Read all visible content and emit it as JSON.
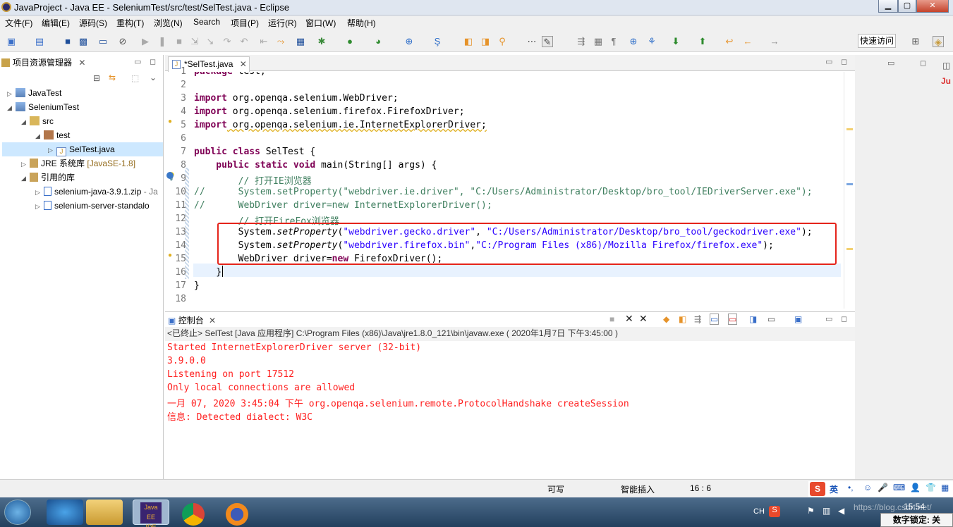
{
  "window": {
    "title": "JavaProject - Java EE - SeleniumTest/src/test/SelTest.java - Eclipse",
    "min": "▁",
    "max": "▢",
    "close": "✕"
  },
  "menu": [
    "文件(F)",
    "编辑(E)",
    "源码(S)",
    "重构(T)",
    "浏览(N)",
    "Search",
    "项目(P)",
    "运行(R)",
    "窗口(W)",
    "帮助(H)"
  ],
  "toolbar": {
    "quick_access": "快速访问"
  },
  "explorer": {
    "tab_label": "项目资源管理器",
    "items": [
      {
        "label": "JavaTest"
      },
      {
        "label": "SeleniumTest"
      },
      {
        "label": "src"
      },
      {
        "label": "test"
      },
      {
        "label": "SelTest.java"
      },
      {
        "label": "JRE 系统库",
        "suffix": "[JavaSE-1.8]"
      },
      {
        "label": "引用的库"
      },
      {
        "label": "selenium-java-3.9.1.zip",
        "suffix": "- Ja"
      },
      {
        "label": "selenium-server-standalo"
      }
    ]
  },
  "editor": {
    "tab_label": "*SelTest.java",
    "line_numbers": [
      "1",
      "2",
      "3",
      "4",
      "5",
      "6",
      "7",
      "8",
      "9",
      "10",
      "11",
      "12",
      "13",
      "14",
      "15",
      "16",
      "17",
      "18"
    ],
    "lines": {
      "l1a": "package",
      "l1b": " test;",
      "l3a": "import",
      "l3b": " org.openqa.selenium.WebDriver;",
      "l4a": "import",
      "l4b": " org.openqa.selenium.firefox.FirefoxDriver;",
      "l5a": "import",
      "l5b": " org.openqa.selenium.ie.InternetExplorerDriver;",
      "l7a": "public class",
      "l7b": " SelTest {",
      "l8a": "    public static void",
      "l8b": " main(String[] args) {",
      "l9": "        // 打开IE浏览器",
      "l10": "//      System.setProperty(\"webdriver.ie.driver\", \"C:/Users/Administrator/Desktop/bro_tool/IEDriverServer.exe\");",
      "l11": "//      WebDriver driver=new InternetExplorerDriver();",
      "l12": "        // 打开FireFox浏览器",
      "l13a": "        System.",
      "l13b": "setProperty",
      "l13c": "(",
      "l13d": "\"webdriver.gecko.driver\"",
      "l13e": ", ",
      "l13f": "\"C:/Users/Administrator/Desktop/bro_tool/geckodriver.exe\"",
      "l13g": ");",
      "l14a": "        System.",
      "l14b": "setProperty",
      "l14c": "(",
      "l14d": "\"webdriver.firefox.bin\"",
      "l14e": ",",
      "l14f": "\"C:/Program Files (x86)/Mozilla Firefox/firefox.exe\"",
      "l14g": ");",
      "l15a": "        WebDriver driver=",
      "l15b": "new",
      "l15c": " FirefoxDriver();",
      "l16": "    }",
      "l17": "}"
    }
  },
  "console": {
    "tab_label": "控制台",
    "header": "<已终止> SelTest [Java 应用程序] C:\\Program Files (x86)\\Java\\jre1.8.0_121\\bin\\javaw.exe ( 2020年1月7日 下午3:45:00 )",
    "lines": [
      "Started InternetExplorerDriver server (32-bit)",
      "3.9.0.0",
      "Listening on port 17512",
      "Only local connections are allowed",
      "一月 07, 2020 3:45:04 下午 org.openqa.selenium.remote.ProtocolHandshake createSession",
      "信息: Detected dialect: W3C"
    ]
  },
  "status": {
    "writable": "可写",
    "insert_mode": "智能插入",
    "position": "16 : 6"
  },
  "taskbar": {
    "clock": "15:54",
    "lang": "CH",
    "ime": "英",
    "numlock": "数字锁定: 关",
    "watermark": "https://blog.csdn.net/"
  },
  "colors": {
    "keyword": "#7f0055",
    "comment": "#3f7f5f",
    "string": "#2a00ff",
    "console_error": "#ff1f1f",
    "highlight_box": "#e5241b"
  }
}
